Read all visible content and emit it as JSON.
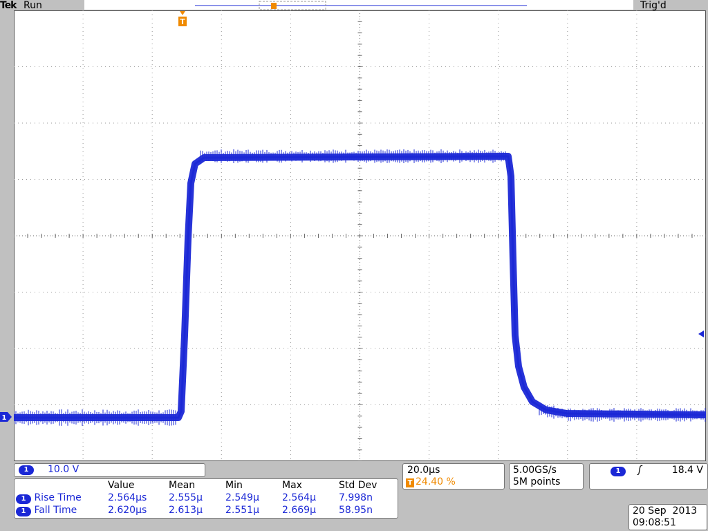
{
  "header": {
    "brand": "Tek",
    "run_status": "Run",
    "trigger_status": "Trig'd"
  },
  "channel": {
    "id": "1",
    "scale": "10.0 V"
  },
  "horizontal": {
    "scale": "20.0µs",
    "trigger_position": "24.40 %"
  },
  "acquisition": {
    "sample_rate": "5.00GS/s",
    "record_length": "5M points"
  },
  "trigger": {
    "source": "1",
    "slope_symbol": "ʃ",
    "level": "18.4 V"
  },
  "measurements": {
    "headers": [
      "",
      "Value",
      "Mean",
      "Min",
      "Max",
      "Std Dev"
    ],
    "rows": [
      {
        "channel": "1",
        "name": "Rise Time",
        "value": "2.564µs",
        "mean": "2.555µ",
        "min": "2.549µ",
        "max": "2.564µ",
        "std_dev": "7.998n"
      },
      {
        "channel": "1",
        "name": "Fall Time",
        "value": "2.620µs",
        "mean": "2.613µ",
        "min": "2.551µ",
        "max": "2.669µ",
        "std_dev": "58.95n"
      }
    ]
  },
  "datetime": {
    "date": "20 Sep  2013",
    "time": "09:08:51"
  },
  "markers": {
    "trigger_marker": "T",
    "ground_marker": "1"
  },
  "colors": {
    "trace": "#1b28d6",
    "trigger": "#f08a00",
    "background": "#c0c0c0"
  }
}
